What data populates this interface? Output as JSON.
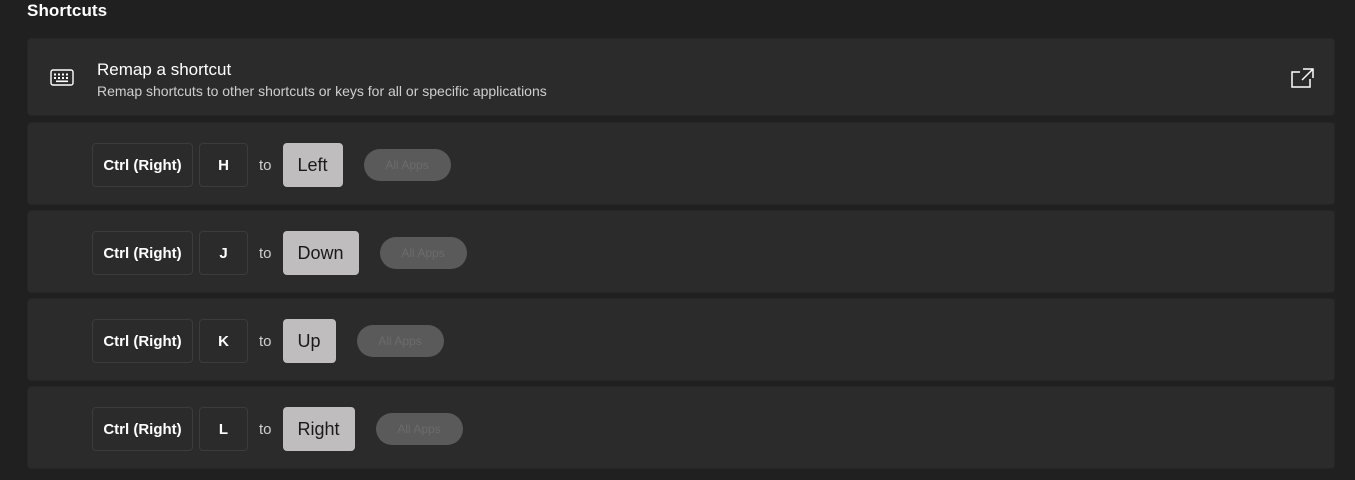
{
  "section": {
    "title": "Shortcuts"
  },
  "header": {
    "icon": "keyboard-icon",
    "title": "Remap a shortcut",
    "subtitle": "Remap shortcuts to other shortcuts or keys for all or specific applications",
    "open_icon": "open-external-icon"
  },
  "mappings": [
    {
      "modifier": "Ctrl (Right)",
      "key": "H",
      "to_label": "to",
      "target": "Left",
      "scope": "All Apps"
    },
    {
      "modifier": "Ctrl (Right)",
      "key": "J",
      "to_label": "to",
      "target": "Down",
      "scope": "All Apps"
    },
    {
      "modifier": "Ctrl (Right)",
      "key": "K",
      "to_label": "to",
      "target": "Up",
      "scope": "All Apps"
    },
    {
      "modifier": "Ctrl (Right)",
      "key": "L",
      "to_label": "to",
      "target": "Right",
      "scope": "All Apps"
    }
  ],
  "colors": {
    "background": "#202020",
    "card": "#2b2b2b",
    "target_key": "#bfbdbd",
    "scope_pill": "#5a5a5a"
  }
}
